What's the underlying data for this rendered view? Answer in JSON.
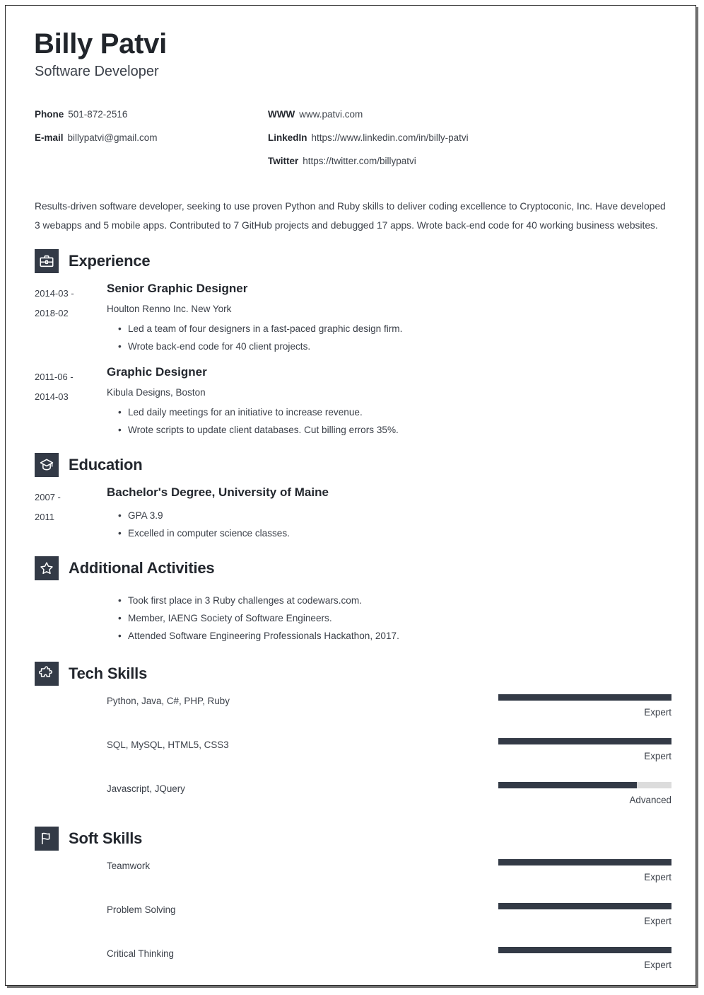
{
  "header": {
    "name": "Billy Patvi",
    "job_title": "Software Developer",
    "contacts_left": [
      {
        "label": "Phone",
        "value": "501-872-2516"
      },
      {
        "label": "E-mail",
        "value": "billypatvi@gmail.com"
      }
    ],
    "contacts_right": [
      {
        "label": "WWW",
        "value": "www.patvi.com"
      },
      {
        "label": "LinkedIn",
        "value": "https://www.linkedin.com/in/billy-patvi"
      },
      {
        "label": "Twitter",
        "value": "https://twitter.com/billypatvi"
      }
    ]
  },
  "summary": "Results-driven software developer, seeking to use proven Python and Ruby skills to deliver coding excellence to Cryptoconic, Inc. Have developed 3 webapps and 5 mobile apps. Contributed to 7 GitHub projects and debugged 17 apps. Wrote back-end code for 40 working business websites.",
  "sections": {
    "experience": {
      "title": "Experience",
      "icon": "briefcase-icon",
      "entries": [
        {
          "date_start": "2014-03 -",
          "date_end": "2018-02",
          "role": "Senior Graphic Designer",
          "org": "Houlton Renno Inc. New York",
          "bullets": [
            "Led a team of four designers in a fast-paced graphic design firm.",
            "Wrote back-end code for 40 client projects."
          ]
        },
        {
          "date_start": "2011-06 -",
          "date_end": "2014-03",
          "role": "Graphic Designer",
          "org": "Kibula Designs, Boston",
          "bullets": [
            "Led daily meetings for an initiative to increase revenue.",
            "Wrote scripts to update client databases. Cut billing errors 35%."
          ]
        }
      ]
    },
    "education": {
      "title": "Education",
      "icon": "graduation-cap-icon",
      "entries": [
        {
          "date_start": "2007 -",
          "date_end": "2011",
          "role": "Bachelor's Degree, University of Maine",
          "org": "",
          "bullets": [
            "GPA 3.9",
            "Excelled in computer science classes."
          ]
        }
      ]
    },
    "activities": {
      "title": "Additional Activities",
      "icon": "star-icon",
      "bullets": [
        "Took first place in 3 Ruby challenges at codewars.com.",
        "Member, IAENG Society of Software Engineers.",
        "Attended Software Engineering Professionals Hackathon, 2017."
      ]
    },
    "tech_skills": {
      "title": "Tech Skills",
      "icon": "puzzle-piece-icon",
      "skills": [
        {
          "name": "Python, Java, C#, PHP, Ruby",
          "level": "Expert",
          "percent": 100
        },
        {
          "name": "SQL, MySQL, HTML5, CSS3",
          "level": "Expert",
          "percent": 100
        },
        {
          "name": "Javascript, JQuery",
          "level": "Advanced",
          "percent": 80
        }
      ]
    },
    "soft_skills": {
      "title": "Soft Skills",
      "icon": "flag-icon",
      "skills": [
        {
          "name": "Teamwork",
          "level": "Expert",
          "percent": 100
        },
        {
          "name": "Problem Solving",
          "level": "Expert",
          "percent": 100
        },
        {
          "name": "Critical Thinking",
          "level": "Expert",
          "percent": 100
        }
      ]
    }
  },
  "colors": {
    "accent_dark": "#333a46",
    "text": "#3a3f48",
    "heading": "#23272e",
    "bar_track": "#dcdcdc"
  }
}
